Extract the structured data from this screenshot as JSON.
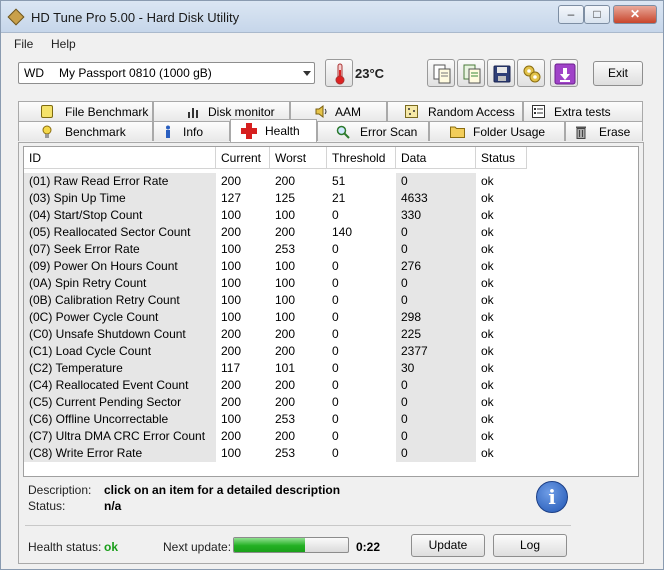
{
  "window": {
    "title": "HD Tune Pro 5.00 - Hard Disk Utility",
    "controls": {
      "minimize": "‒",
      "maximize": "□",
      "close": "✕"
    }
  },
  "menu": {
    "file": "File",
    "help": "Help"
  },
  "toolbar": {
    "drive_vendor": "WD",
    "drive_name": "My Passport 0810 (1000 gB)",
    "temperature": "23°C",
    "exit_label": "Exit",
    "icons": [
      "thermometer-icon",
      "copy-icon",
      "copy-all-icon",
      "save-icon",
      "options-icon",
      "download-icon"
    ]
  },
  "tabs": {
    "top_row": [
      "File Benchmark",
      "Disk monitor",
      "AAM",
      "Random Access",
      "Extra tests"
    ],
    "bottom_row": [
      "Benchmark",
      "Info",
      "Health",
      "Error Scan",
      "Folder Usage",
      "Erase"
    ],
    "active": "Health"
  },
  "table": {
    "columns": [
      "ID",
      "Current",
      "Worst",
      "Threshold",
      "Data",
      "Status"
    ],
    "rows": [
      [
        "(01) Raw Read Error Rate",
        "200",
        "200",
        "51",
        "0",
        "ok"
      ],
      [
        "(03) Spin Up Time",
        "127",
        "125",
        "21",
        "4633",
        "ok"
      ],
      [
        "(04) Start/Stop Count",
        "100",
        "100",
        "0",
        "330",
        "ok"
      ],
      [
        "(05) Reallocated Sector Count",
        "200",
        "200",
        "140",
        "0",
        "ok"
      ],
      [
        "(07) Seek Error Rate",
        "100",
        "253",
        "0",
        "0",
        "ok"
      ],
      [
        "(09) Power On Hours Count",
        "100",
        "100",
        "0",
        "276",
        "ok"
      ],
      [
        "(0A) Spin Retry Count",
        "100",
        "100",
        "0",
        "0",
        "ok"
      ],
      [
        "(0B) Calibration Retry Count",
        "100",
        "100",
        "0",
        "0",
        "ok"
      ],
      [
        "(0C) Power Cycle Count",
        "100",
        "100",
        "0",
        "298",
        "ok"
      ],
      [
        "(C0) Unsafe Shutdown Count",
        "200",
        "200",
        "0",
        "225",
        "ok"
      ],
      [
        "(C1) Load Cycle Count",
        "200",
        "200",
        "0",
        "2377",
        "ok"
      ],
      [
        "(C2) Temperature",
        "117",
        "101",
        "0",
        "30",
        "ok"
      ],
      [
        "(C4) Reallocated Event Count",
        "200",
        "200",
        "0",
        "0",
        "ok"
      ],
      [
        "(C5) Current Pending Sector",
        "200",
        "200",
        "0",
        "0",
        "ok"
      ],
      [
        "(C6) Offline Uncorrectable",
        "100",
        "253",
        "0",
        "0",
        "ok"
      ],
      [
        "(C7) Ultra DMA CRC Error Count",
        "200",
        "200",
        "0",
        "0",
        "ok"
      ],
      [
        "(C8) Write Error Rate",
        "100",
        "253",
        "0",
        "0",
        "ok"
      ]
    ]
  },
  "description": {
    "desc_label": "Description:",
    "desc_value": "click on an item for a detailed description",
    "status_label": "Status:",
    "status_value": "n/a"
  },
  "footer": {
    "health_label": "Health status:",
    "health_value": "ok",
    "health_color": "#1a9e1a",
    "next_update_label": "Next update:",
    "next_update_value": "0:22",
    "progress_fraction": 0.62,
    "update_label": "Update",
    "log_label": "Log"
  }
}
